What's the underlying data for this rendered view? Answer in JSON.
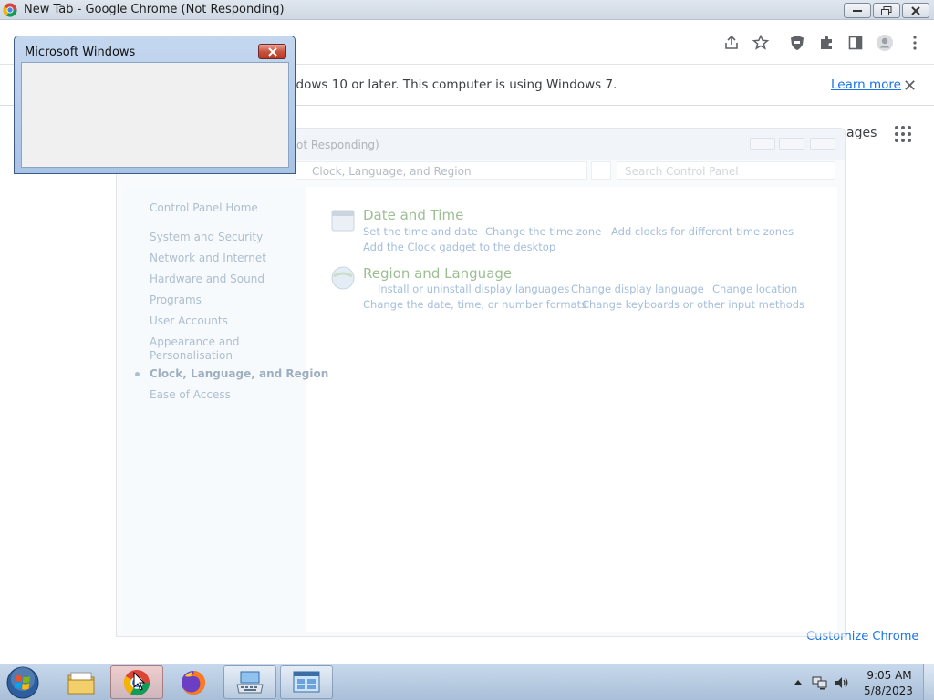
{
  "chrome_window": {
    "title": "New Tab - Google Chrome (Not Responding)",
    "infobar": {
      "message": "ndows 10 or later. This computer is using Windows 7.",
      "learn_more": "Learn more",
      "close_glyph": "✕"
    },
    "ntp_partial_link": "ages",
    "customize_label": "Customize Chrome",
    "toolbar_icons": [
      "share-icon",
      "bookmark-star-icon",
      "shield-extension-icon",
      "puzzle-extensions-icon",
      "side-panel-icon",
      "profile-avatar-icon",
      "kebab-menu-icon"
    ]
  },
  "control_panel": {
    "title_partial": "Not Responding)",
    "address_path": "Clock, Language, and Region",
    "search_placeholder": "Search Control Panel",
    "nav": {
      "home": "Control Panel Home",
      "items": [
        "System and Security",
        "Network and Internet",
        "Hardware and Sound",
        "Programs",
        "User Accounts",
        "Appearance and",
        "Personalisation",
        "Clock, Language, and Region",
        "Ease of Access"
      ]
    },
    "categories": [
      {
        "title": "Date and Time",
        "links": [
          "Set the time and date",
          "Change the time zone",
          "Add clocks for different time zones",
          "Add the Clock gadget to the desktop"
        ]
      },
      {
        "title": "Region and Language",
        "links": [
          "Install or uninstall display languages",
          "Change display language",
          "Change location",
          "Change the date, time, or number formats",
          "Change keyboards or other input methods"
        ]
      }
    ]
  },
  "dialog": {
    "title": "Microsoft Windows"
  },
  "taskbar": {
    "apps": [
      "file-explorer-icon",
      "chrome-icon",
      "firefox-icon",
      "keyboard-app-icon",
      "control-panel-icon"
    ],
    "time": "9:05 AM",
    "date": "5/8/2023"
  }
}
